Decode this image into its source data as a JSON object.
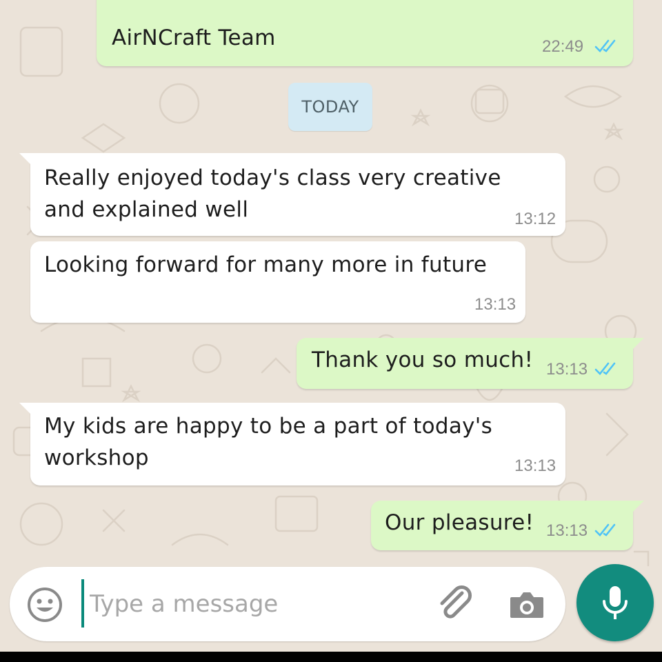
{
  "colors": {
    "outgoing_bubble": "#dcf8c6",
    "incoming_bubble": "#ffffff",
    "read_ticks": "#4fc3f7",
    "mic_button": "#128c7e",
    "date_chip": "#d4eaf4"
  },
  "messages": [
    {
      "direction": "out",
      "text": "AirNCraft Team",
      "time": "22:49",
      "status": "read"
    },
    {
      "direction": "in",
      "line1": "Really enjoyed  today's class very creative",
      "line2": "and explained well",
      "time": "13:12"
    },
    {
      "direction": "in",
      "text": "Looking forward for many more in future",
      "time": "13:13"
    },
    {
      "direction": "out",
      "text": "Thank you so much!",
      "time": "13:13",
      "status": "read"
    },
    {
      "direction": "in",
      "line1": "My kids are happy to be a part of today's",
      "line2": "workshop",
      "time": "13:13"
    },
    {
      "direction": "out",
      "text": "Our pleasure!",
      "time": "13:13",
      "status": "read"
    }
  ],
  "date_divider": "TODAY",
  "composer": {
    "placeholder": "Type a message",
    "emoji_icon": "smiley-icon",
    "attach_icon": "paperclip-icon",
    "camera_icon": "camera-icon",
    "mic_icon": "microphone-icon"
  }
}
